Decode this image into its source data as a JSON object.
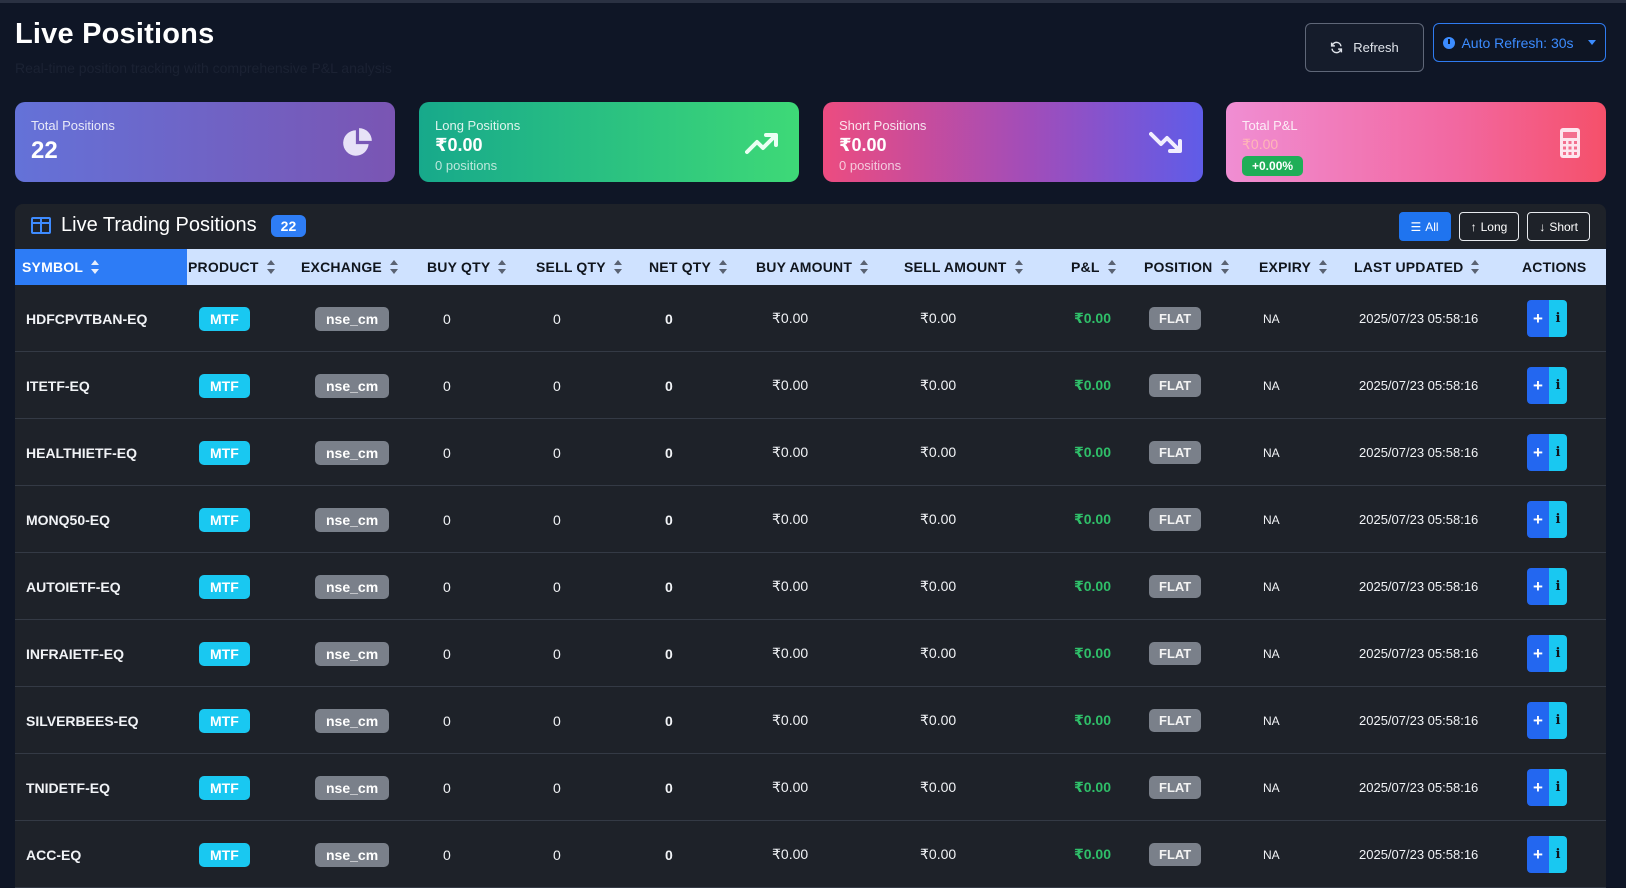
{
  "header": {
    "title": "Live Positions",
    "subtitle": "Real-time position tracking with comprehensive P&L analysis",
    "refresh_label": "Refresh",
    "auto_refresh_label": "Auto Refresh: 30s"
  },
  "cards": {
    "total_positions": {
      "label": "Total Positions",
      "value": "22",
      "icon": "chart-pie-icon"
    },
    "long_positions": {
      "label": "Long Positions",
      "value": "₹0.00",
      "sub": "0 positions",
      "icon": "trending-up-icon"
    },
    "short_positions": {
      "label": "Short Positions",
      "value": "₹0.00",
      "sub": "0 positions",
      "icon": "trending-down-icon"
    },
    "total_pnl": {
      "label": "Total P&L",
      "value": "₹0.00",
      "badge": "+0.00%",
      "icon": "calculator-icon"
    }
  },
  "panel": {
    "title": "Live Trading Positions",
    "count": "22",
    "filters": {
      "all": "All",
      "long": "Long",
      "short": "Short"
    }
  },
  "table": {
    "columns": [
      "SYMBOL",
      "PRODUCT",
      "EXCHANGE",
      "BUY QTY",
      "SELL QTY",
      "NET QTY",
      "BUY AMOUNT",
      "SELL AMOUNT",
      "P&L",
      "POSITION",
      "EXPIRY",
      "LAST UPDATED",
      "ACTIONS"
    ],
    "rows": [
      {
        "symbol": "HDFCPVTBAN-EQ",
        "product": "MTF",
        "exchange": "nse_cm",
        "buy_qty": "0",
        "sell_qty": "0",
        "net_qty": "0",
        "buy_amount": "₹0.00",
        "sell_amount": "₹0.00",
        "pnl": "₹0.00",
        "position": "FLAT",
        "expiry": "NA",
        "last_updated": "2025/07/23 05:58:16"
      },
      {
        "symbol": "ITETF-EQ",
        "product": "MTF",
        "exchange": "nse_cm",
        "buy_qty": "0",
        "sell_qty": "0",
        "net_qty": "0",
        "buy_amount": "₹0.00",
        "sell_amount": "₹0.00",
        "pnl": "₹0.00",
        "position": "FLAT",
        "expiry": "NA",
        "last_updated": "2025/07/23 05:58:16"
      },
      {
        "symbol": "HEALTHIETF-EQ",
        "product": "MTF",
        "exchange": "nse_cm",
        "buy_qty": "0",
        "sell_qty": "0",
        "net_qty": "0",
        "buy_amount": "₹0.00",
        "sell_amount": "₹0.00",
        "pnl": "₹0.00",
        "position": "FLAT",
        "expiry": "NA",
        "last_updated": "2025/07/23 05:58:16"
      },
      {
        "symbol": "MONQ50-EQ",
        "product": "MTF",
        "exchange": "nse_cm",
        "buy_qty": "0",
        "sell_qty": "0",
        "net_qty": "0",
        "buy_amount": "₹0.00",
        "sell_amount": "₹0.00",
        "pnl": "₹0.00",
        "position": "FLAT",
        "expiry": "NA",
        "last_updated": "2025/07/23 05:58:16"
      },
      {
        "symbol": "AUTOIETF-EQ",
        "product": "MTF",
        "exchange": "nse_cm",
        "buy_qty": "0",
        "sell_qty": "0",
        "net_qty": "0",
        "buy_amount": "₹0.00",
        "sell_amount": "₹0.00",
        "pnl": "₹0.00",
        "position": "FLAT",
        "expiry": "NA",
        "last_updated": "2025/07/23 05:58:16"
      },
      {
        "symbol": "INFRAIETF-EQ",
        "product": "MTF",
        "exchange": "nse_cm",
        "buy_qty": "0",
        "sell_qty": "0",
        "net_qty": "0",
        "buy_amount": "₹0.00",
        "sell_amount": "₹0.00",
        "pnl": "₹0.00",
        "position": "FLAT",
        "expiry": "NA",
        "last_updated": "2025/07/23 05:58:16"
      },
      {
        "symbol": "SILVERBEES-EQ",
        "product": "MTF",
        "exchange": "nse_cm",
        "buy_qty": "0",
        "sell_qty": "0",
        "net_qty": "0",
        "buy_amount": "₹0.00",
        "sell_amount": "₹0.00",
        "pnl": "₹0.00",
        "position": "FLAT",
        "expiry": "NA",
        "last_updated": "2025/07/23 05:58:16"
      },
      {
        "symbol": "TNIDETF-EQ",
        "product": "MTF",
        "exchange": "nse_cm",
        "buy_qty": "0",
        "sell_qty": "0",
        "net_qty": "0",
        "buy_amount": "₹0.00",
        "sell_amount": "₹0.00",
        "pnl": "₹0.00",
        "position": "FLAT",
        "expiry": "NA",
        "last_updated": "2025/07/23 05:58:16"
      },
      {
        "symbol": "ACC-EQ",
        "product": "MTF",
        "exchange": "nse_cm",
        "buy_qty": "0",
        "sell_qty": "0",
        "net_qty": "0",
        "buy_amount": "₹0.00",
        "sell_amount": "₹0.00",
        "pnl": "₹0.00",
        "position": "FLAT",
        "expiry": "NA",
        "last_updated": "2025/07/23 05:58:16"
      }
    ]
  },
  "colors": {
    "background": "#0f1626",
    "accent": "#2d7cf6",
    "pnl_positive": "#2fbf69",
    "badge_info": "#19c8f1"
  }
}
